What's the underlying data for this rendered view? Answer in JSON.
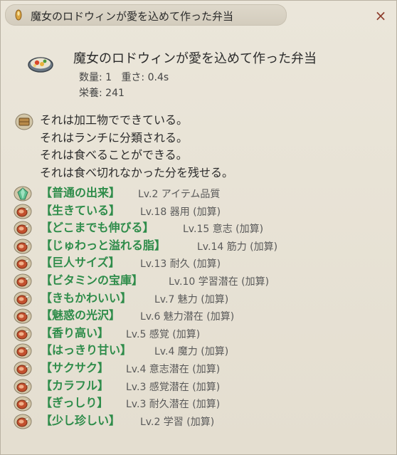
{
  "window": {
    "title": "魔女のロドウィンが愛を込めて作った弁当",
    "close_label": "×"
  },
  "item": {
    "name": "魔女のロドウィンが愛を込めて作った弁当",
    "quantity": "数量: 1",
    "weight": "重さ: 0.4s",
    "nutrition": "栄養: 241"
  },
  "description": [
    "それは加工物でできている。",
    "それはランチに分類される。",
    "それは食べることができる。",
    "それは食べ切れなかった分を残せる。"
  ],
  "traits": [
    {
      "name": "【普通の出来】",
      "detail": "Lv.2 アイテム品質",
      "icon": "green-gem-icon",
      "color": "#2e8c4a"
    },
    {
      "name": "【生きている】",
      "detail": "Lv.18 器用 (加算)",
      "icon": "meat-icon",
      "color": "#2e8c4a"
    },
    {
      "name": "【どこまでも伸びる】",
      "detail": "Lv.15 意志 (加算)",
      "icon": "meat-icon",
      "color": "#2e8c4a"
    },
    {
      "name": "【じゅわっと溢れる脂】",
      "detail": "Lv.14 筋力 (加算)",
      "icon": "meat-icon",
      "color": "#2e8c4a"
    },
    {
      "name": "【巨人サイズ】",
      "detail": "Lv.13 耐久 (加算)",
      "icon": "meat-icon",
      "color": "#2e8c4a"
    },
    {
      "name": "【ビタミンの宝庫】",
      "detail": "Lv.10 学習潜在 (加算)",
      "icon": "meat-icon",
      "color": "#2e8c4a"
    },
    {
      "name": "【きもかわいい】",
      "detail": "Lv.7 魅力 (加算)",
      "icon": "meat-icon",
      "color": "#2e8c4a"
    },
    {
      "name": "【魅惑の光沢】",
      "detail": "Lv.6 魅力潜在 (加算)",
      "icon": "meat-icon",
      "color": "#2e8c4a"
    },
    {
      "name": "【香り高い】",
      "detail": "Lv.5 感覚 (加算)",
      "icon": "meat-icon",
      "color": "#2e8c4a"
    },
    {
      "name": "【はっきり甘い】",
      "detail": "Lv.4 魔力 (加算)",
      "icon": "meat-icon",
      "color": "#2e8c4a"
    },
    {
      "name": "【サクサク】",
      "detail": "Lv.4 意志潜在 (加算)",
      "icon": "meat-icon",
      "color": "#2e8c4a"
    },
    {
      "name": "【カラフル】",
      "detail": "Lv.3 感覚潜在 (加算)",
      "icon": "meat-icon",
      "color": "#2e8c4a"
    },
    {
      "name": "【ぎっしり】",
      "detail": "Lv.3 耐久潜在 (加算)",
      "icon": "meat-icon",
      "color": "#2e8c4a"
    },
    {
      "name": "【少し珍しい】",
      "detail": "Lv.2 学習 (加算)",
      "icon": "meat-icon",
      "color": "#2e8c4a"
    }
  ]
}
